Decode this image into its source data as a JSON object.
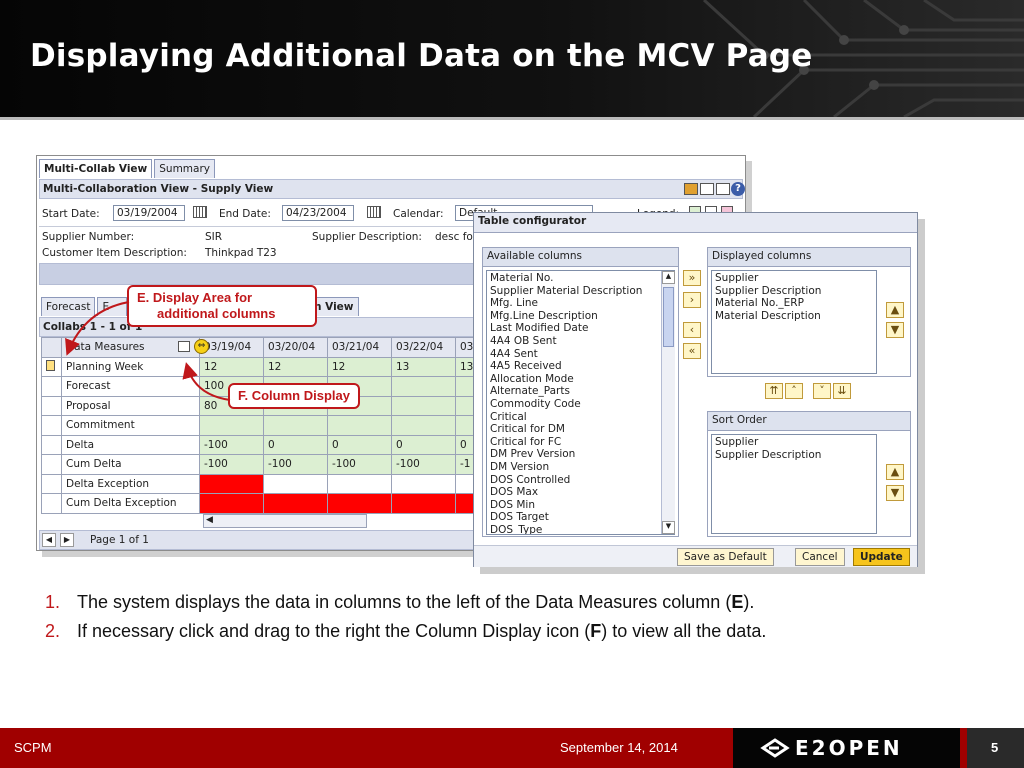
{
  "slide": {
    "title": "Displaying Additional Data on the MCV Page",
    "footer_left": "SCPM",
    "footer_date": "September 14, 2014",
    "page_number": "5",
    "logo_text": "E2OPEN"
  },
  "mcv": {
    "tabs": [
      "Multi-Collab View",
      "Summary"
    ],
    "header": "Multi-Collaboration View - Supply View",
    "start_date_label": "Start Date:",
    "start_date": "03/19/2004",
    "end_date_label": "End Date:",
    "end_date": "04/23/2004",
    "calendar_label": "Calendar:",
    "calendar_value": "Default",
    "legend_label": "Legend:",
    "supplier_number_label": "Supplier Number:",
    "supplier_number": "SIR",
    "supplier_desc_label": "Supplier Description:",
    "supplier_desc": "desc fo",
    "cust_item_label": "Customer Item Description:",
    "cust_item": "Thinkpad T23",
    "sub_tabs": [
      "Forecast",
      "E",
      "n View"
    ],
    "collabs": "Collabs 1 - 1 of 1",
    "data_measures_label": "Data Measures",
    "date_cols": [
      "03/19/04",
      "03/20/04",
      "03/21/04",
      "03/22/04",
      "03"
    ],
    "rows": [
      {
        "label": "Planning Week",
        "vals": [
          "12",
          "12",
          "12",
          "13",
          "13"
        ],
        "style": "g"
      },
      {
        "label": "Forecast",
        "vals": [
          "100",
          "",
          "",
          "",
          ""
        ],
        "style": "g"
      },
      {
        "label": "Proposal",
        "vals": [
          "80",
          "",
          "",
          "",
          ""
        ],
        "style": "g"
      },
      {
        "label": "Commitment",
        "vals": [
          "",
          "",
          "",
          "",
          ""
        ],
        "style": "g"
      },
      {
        "label": "Delta",
        "vals": [
          "-100",
          "0",
          "0",
          "0",
          "0"
        ],
        "style": "g"
      },
      {
        "label": "Cum Delta",
        "vals": [
          "-100",
          "-100",
          "-100",
          "-100",
          "-1"
        ],
        "style": "g"
      },
      {
        "label": "Delta Exception",
        "vals": [
          "",
          "",
          "",
          "",
          ""
        ],
        "style": "r1"
      },
      {
        "label": "Cum Delta Exception",
        "vals": [
          "",
          "",
          "",
          "",
          ""
        ],
        "style": "r"
      }
    ],
    "page_label": "Page 1 of 1"
  },
  "configurator": {
    "title": "Table configurator",
    "available_header": "Available columns",
    "available": [
      "Material No.",
      "Supplier Material Description",
      "Mfg. Line",
      "Mfg.Line Description",
      "Last Modified Date",
      "4A4 OB Sent",
      "4A4 Sent",
      "4A5 Received",
      "Allocation Mode",
      "Alternate_Parts",
      "Commodity Code",
      "Critical",
      "Critical for DM",
      "Critical for FC",
      "DM Prev Version",
      "DM Version",
      "DOS Controlled",
      "DOS Max",
      "DOS Min",
      "DOS Target",
      "DOS_Type"
    ],
    "displayed_header": "Displayed columns",
    "displayed": [
      "Supplier",
      "Supplier Description",
      "Material No._ERP",
      "Material Description"
    ],
    "sort_header": "Sort Order",
    "sort": [
      "Supplier",
      "Supplier Description"
    ],
    "btn_save_default": "Save as Default",
    "btn_cancel": "Cancel",
    "btn_update": "Update"
  },
  "callouts": {
    "e_line1": "E. Display Area for",
    "e_line2": "additional columns",
    "f": "F. Column Display"
  },
  "bullets": [
    {
      "num": "1.",
      "pre": "The system displays the data in columns to the left of the Data Measures column (",
      "bold": "E",
      "post": ")."
    },
    {
      "num": "2.",
      "pre": "If necessary click and drag to the right the Column Display icon (",
      "bold": "F",
      "post": ") to view all the data."
    }
  ],
  "colors": {
    "accent_red": "#c0181b",
    "footer_red": "#a00000",
    "grid_green": "#dcefd2",
    "exception_red": "#ff0000"
  }
}
